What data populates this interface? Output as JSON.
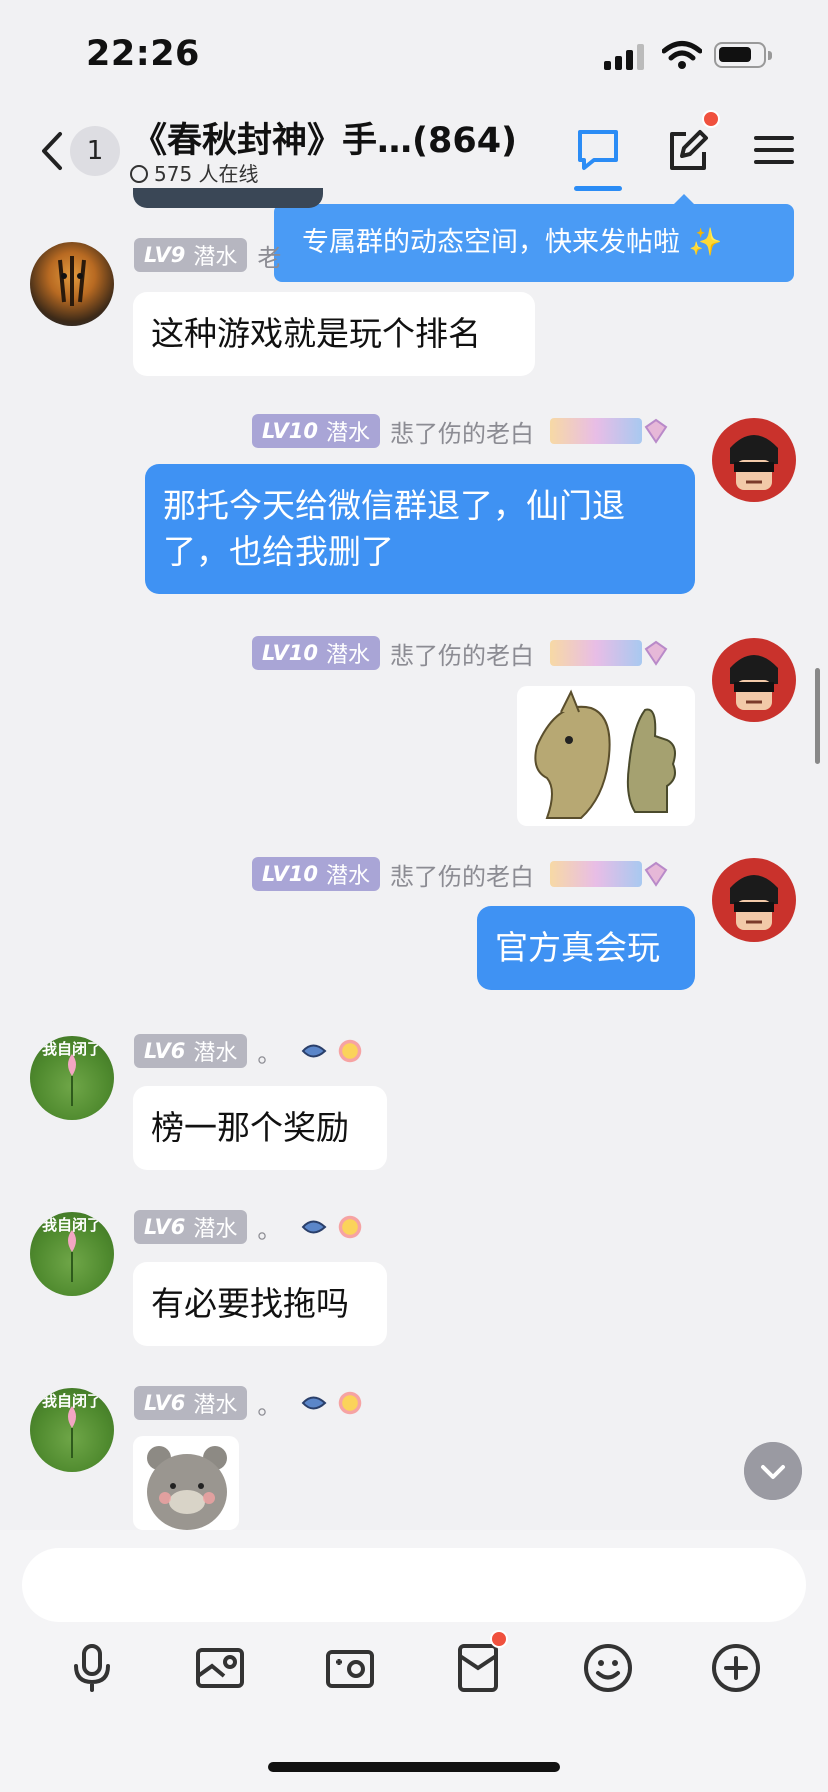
{
  "status_bar": {
    "time": "22:26"
  },
  "header": {
    "unread_count": "1",
    "group_title": "《春秋封神》手…(864)",
    "online_text": "575 人在线"
  },
  "tooltip": {
    "text": "专属群的动态空间，快来发帖啦 ✨"
  },
  "messages": [
    {
      "level": "LV9",
      "rank": "潜水",
      "name": "老",
      "text": "这种游戏就是玩个排名"
    },
    {
      "level": "LV10",
      "rank": "潜水",
      "name": "悲了伤的老白",
      "text": "那托今天给微信群退了，仙门退了，也给我删了"
    },
    {
      "level": "LV10",
      "rank": "潜水",
      "name": "悲了伤的老白"
    },
    {
      "level": "LV10",
      "rank": "潜水",
      "name": "悲了伤的老白",
      "text": "官方真会玩"
    },
    {
      "level": "LV6",
      "rank": "潜水",
      "name": "。",
      "text": "榜一那个奖励"
    },
    {
      "level": "LV6",
      "rank": "潜水",
      "name": "。",
      "text": "有必要找拖吗"
    },
    {
      "level": "LV6",
      "rank": "潜水",
      "name": "。"
    }
  ],
  "avatars": {
    "lotus_caption": "我自闭了"
  },
  "input": {
    "placeholder": ""
  },
  "colors": {
    "accent": "#3f92f3",
    "badge_dot": "#f0513e"
  }
}
